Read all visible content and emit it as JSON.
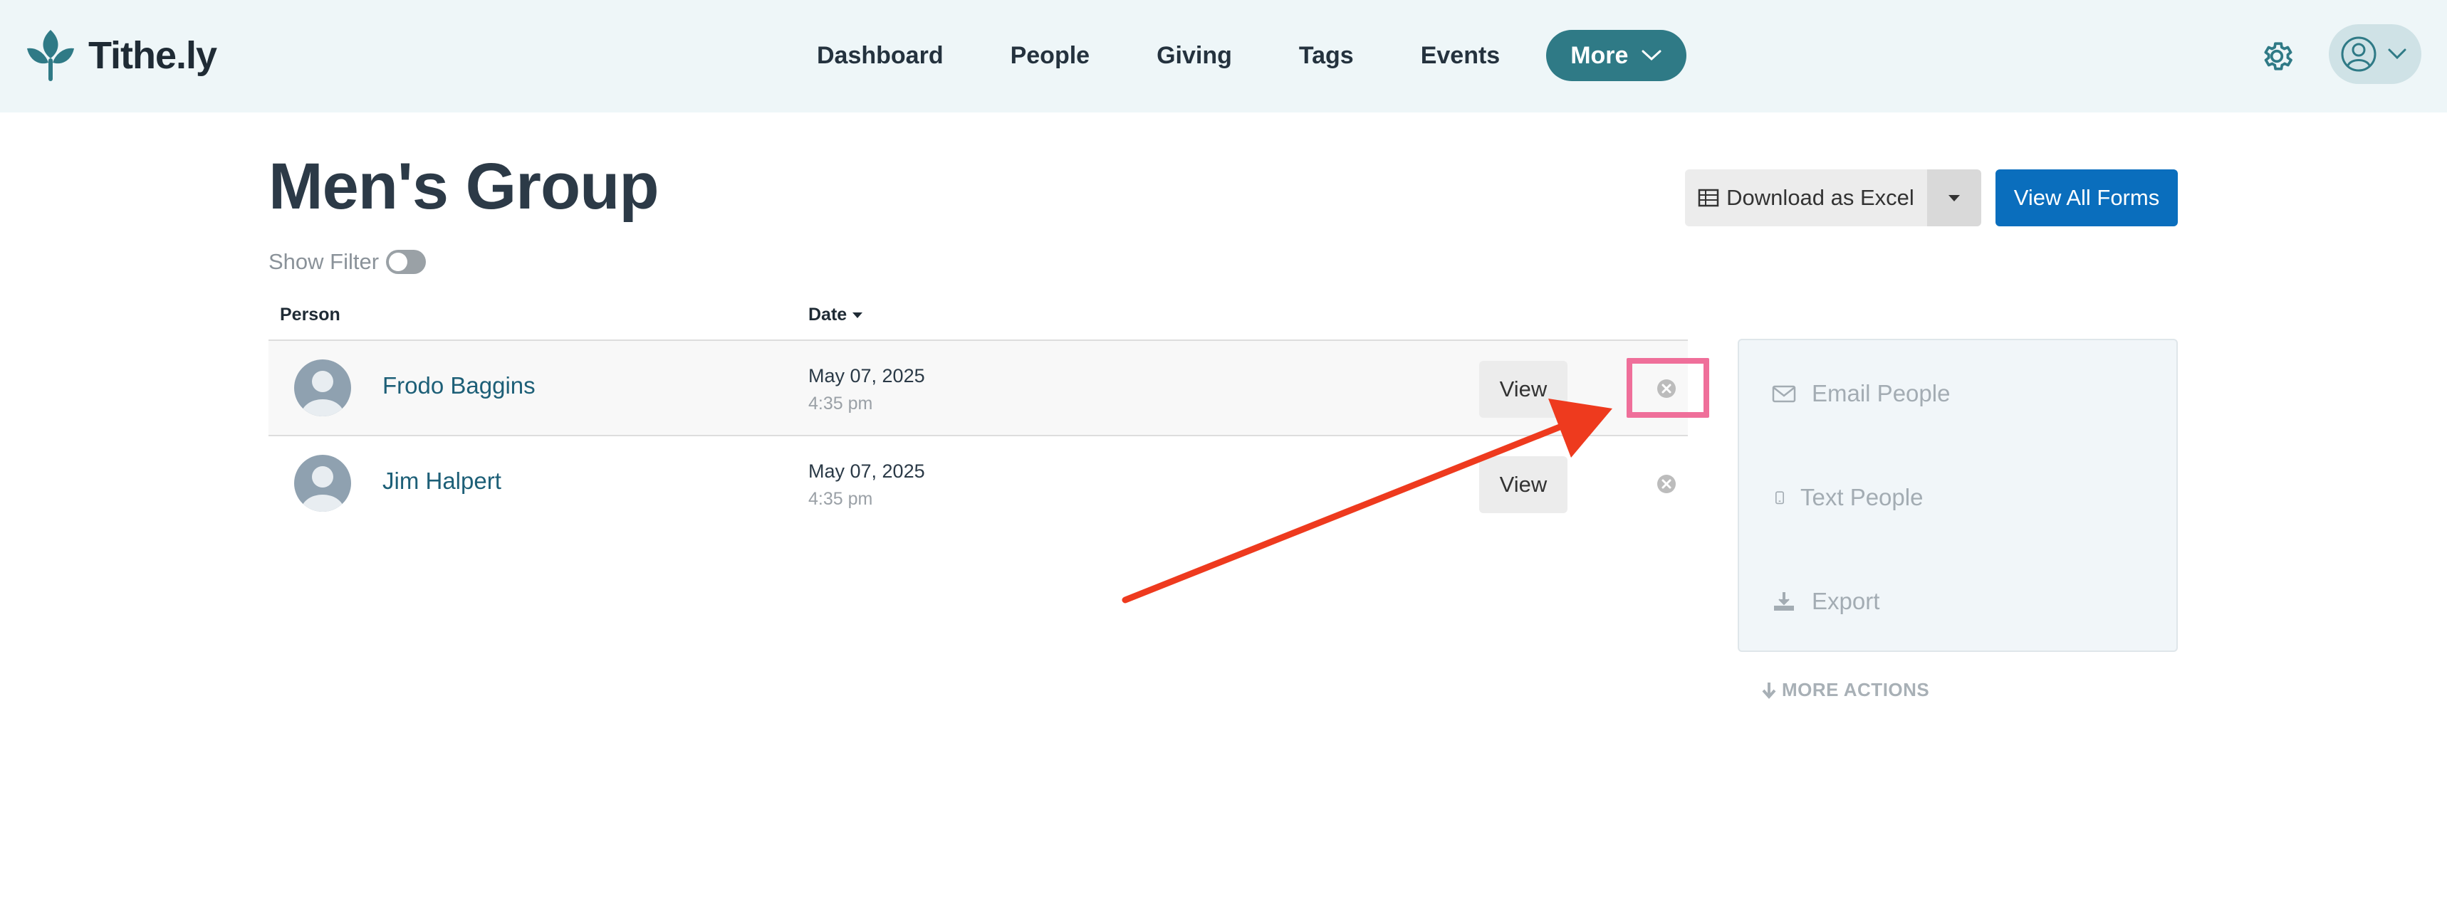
{
  "header": {
    "brand": "Tithe.ly",
    "nav": [
      "Dashboard",
      "People",
      "Giving",
      "Tags",
      "Events"
    ],
    "more_label": "More"
  },
  "page": {
    "title": "Men's Group",
    "show_filter_label": "Show Filter",
    "download_label": "Download as Excel",
    "view_all_forms_label": "View All Forms"
  },
  "table": {
    "columns": {
      "person": "Person",
      "date": "Date"
    },
    "rows": [
      {
        "name": "Frodo Baggins",
        "date": "May 07, 2025",
        "time": "4:35 pm",
        "view_label": "View"
      },
      {
        "name": "Jim Halpert",
        "date": "May 07, 2025",
        "time": "4:35 pm",
        "view_label": "View"
      }
    ]
  },
  "actions": {
    "email": "Email People",
    "text": "Text People",
    "export": "Export",
    "more": "MORE ACTIONS"
  },
  "colors": {
    "accent": "#2f7a86",
    "primary_button": "#0a6ebd",
    "annotation_box": "#ef6f9a",
    "annotation_arrow": "#ee3a1e"
  }
}
